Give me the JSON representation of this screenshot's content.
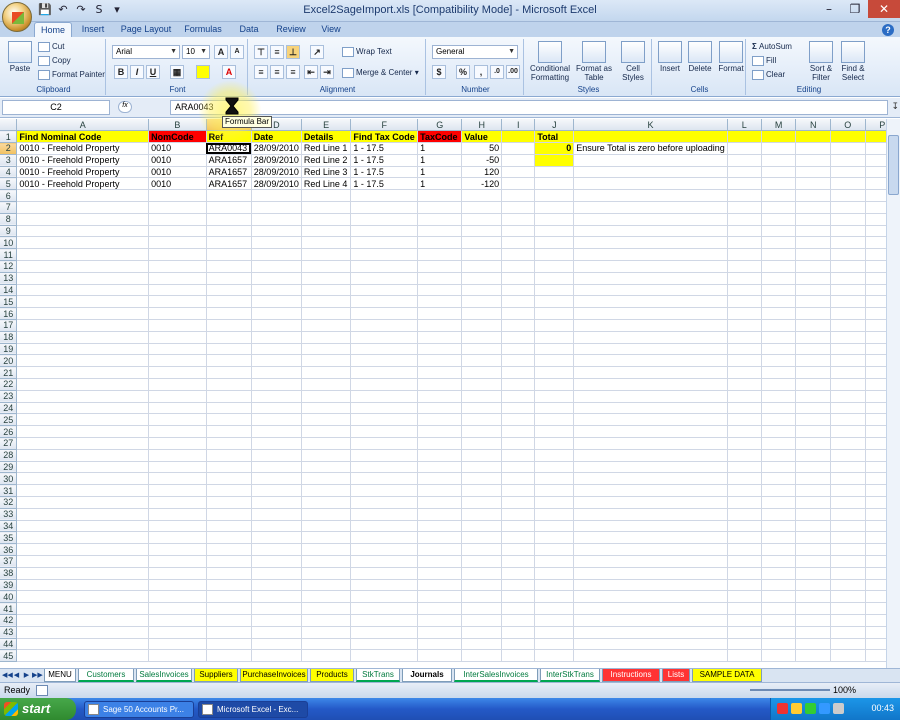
{
  "window": {
    "title": "Excel2SageImport.xls  [Compatibility Mode] - Microsoft Excel"
  },
  "ribbon": {
    "tabs": [
      "Home",
      "Insert",
      "Page Layout",
      "Formulas",
      "Data",
      "Review",
      "View"
    ],
    "clipboard": {
      "label": "Clipboard",
      "paste": "Paste",
      "cut": "Cut",
      "copy": "Copy",
      "format_painter": "Format Painter"
    },
    "font": {
      "label": "Font",
      "name": "Arial",
      "size": "10"
    },
    "alignment": {
      "label": "Alignment",
      "wrap": "Wrap Text",
      "merge": "Merge & Center"
    },
    "number": {
      "label": "Number",
      "format": "General"
    },
    "styles": {
      "label": "Styles",
      "conditional": "Conditional Formatting",
      "format_table": "Format as Table",
      "cell_styles": "Cell Styles"
    },
    "cells": {
      "label": "Cells",
      "insert": "Insert",
      "delete": "Delete",
      "format": "Format"
    },
    "editing": {
      "label": "Editing",
      "autosum": "AutoSum",
      "fill": "Fill",
      "clear": "Clear",
      "sort": "Sort & Filter",
      "find": "Find & Select"
    }
  },
  "formula_bar": {
    "name_box": "C2",
    "value": "ARA0043",
    "tooltip": "Formula Bar"
  },
  "grid": {
    "columns": [
      "A",
      "B",
      "C",
      "D",
      "E",
      "F",
      "G",
      "H",
      "I",
      "J",
      "K",
      "L",
      "M",
      "N",
      "O",
      "P"
    ],
    "row_count": 45,
    "header_row": [
      "Find Nominal Code",
      "NomCode",
      "Ref",
      "Date",
      "Details",
      "Find Tax Code",
      "TaxCode",
      "Value",
      "",
      "Total",
      "",
      "",
      "",
      "",
      "",
      ""
    ],
    "rows": [
      [
        "0010 - Freehold Property",
        "0010",
        "ARA0043",
        "28/09/2010",
        "Red Line 1",
        "1 - 17.5",
        "1",
        "50",
        "",
        "0",
        "Ensure Total is zero before uploading"
      ],
      [
        "0010 - Freehold Property",
        "0010",
        "ARA1657",
        "28/09/2010",
        "Red Line 2",
        "1 - 17.5",
        "1",
        "-50"
      ],
      [
        "0010 - Freehold Property",
        "0010",
        "ARA1657",
        "28/09/2010",
        "Red Line 3",
        "1 - 17.5",
        "1",
        "120"
      ],
      [
        "0010 - Freehold Property",
        "0010",
        "ARA1657",
        "28/09/2010",
        "Red Line 4",
        "1 - 17.5",
        "1",
        "-120"
      ]
    ]
  },
  "sheet_tabs": [
    "MENU",
    "Customers",
    "SalesInvoices",
    "Suppliers",
    "PurchaseInvoices",
    "Products",
    "StkTrans",
    "Journals",
    "InterSalesInvoices",
    "InterStkTrans",
    "Instructions",
    "Lists",
    "SAMPLE DATA"
  ],
  "status_bar": {
    "status": "Ready",
    "zoom": "100%"
  },
  "taskbar": {
    "start": "start",
    "tasks": [
      "Sage 50 Accounts Pr...",
      "Microsoft Excel - Exc..."
    ],
    "clock": "00:43"
  },
  "colors": {
    "header_fill": "#ffff00",
    "header_red": "#ff0000",
    "ribbon_bg": "#dbe7f6"
  }
}
